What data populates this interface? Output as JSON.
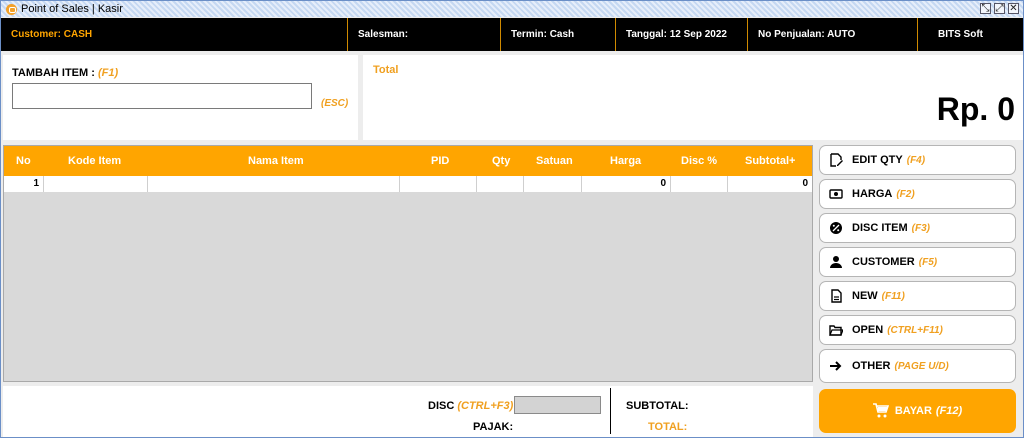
{
  "window": {
    "title": "Point of Sales | Kasir",
    "controls": [
      "restore-icon",
      "maximize-icon",
      "close-icon"
    ]
  },
  "infobar": {
    "customer": "Customer: CASH",
    "salesman": "Salesman:",
    "termin": "Termin: Cash",
    "tanggal": "Tanggal: 12 Sep 2022",
    "no_penjualan": "No Penjualan: AUTO",
    "company": "BITS Soft"
  },
  "entry": {
    "label": "TAMBAH ITEM :",
    "label_key": "(F1)",
    "value": "",
    "placeholder": "",
    "esc_key": "(ESC)"
  },
  "total": {
    "label": "Total",
    "amount": "Rp. 0"
  },
  "table": {
    "columns": [
      "No",
      "Kode Item",
      "Nama Item",
      "PID",
      "Qty",
      "Satuan",
      "Harga",
      "Disc %",
      "Subtotal+"
    ],
    "rows": [
      {
        "no": "1",
        "kode": "",
        "nama": "",
        "pid": "",
        "qty": "",
        "satuan": "",
        "harga": "0",
        "disc": "",
        "subtotal": "0"
      }
    ]
  },
  "actions": [
    {
      "label": "EDIT QTY",
      "key": "(F4)",
      "icon": "edit-icon"
    },
    {
      "label": "HARGA",
      "key": "(F2)",
      "icon": "money-icon"
    },
    {
      "label": "DISC ITEM",
      "key": "(F3)",
      "icon": "discount-icon"
    },
    {
      "label": "CUSTOMER",
      "key": "(F5)",
      "icon": "person-icon"
    },
    {
      "label": "NEW",
      "key": "(F11)",
      "icon": "new-document-icon"
    },
    {
      "label": "OPEN",
      "key": "(CTRL+F11)",
      "icon": "folder-open-icon"
    },
    {
      "label": "OTHER",
      "key": "(PAGE U/D)",
      "icon": "arrow-right-icon"
    }
  ],
  "footer": {
    "disc_label": "DISC",
    "disc_key": "(CTRL+F3)",
    "disc_value": "",
    "pajak_label": "PAJAK:",
    "subtotal_label": "SUBTOTAL:",
    "total_label": "TOTAL:"
  },
  "bayar": {
    "label": "BAYAR",
    "key": "(F12)",
    "icon": "cart-icon"
  },
  "colors": {
    "accent": "#ffa500",
    "infobar_bg": "#000000"
  }
}
